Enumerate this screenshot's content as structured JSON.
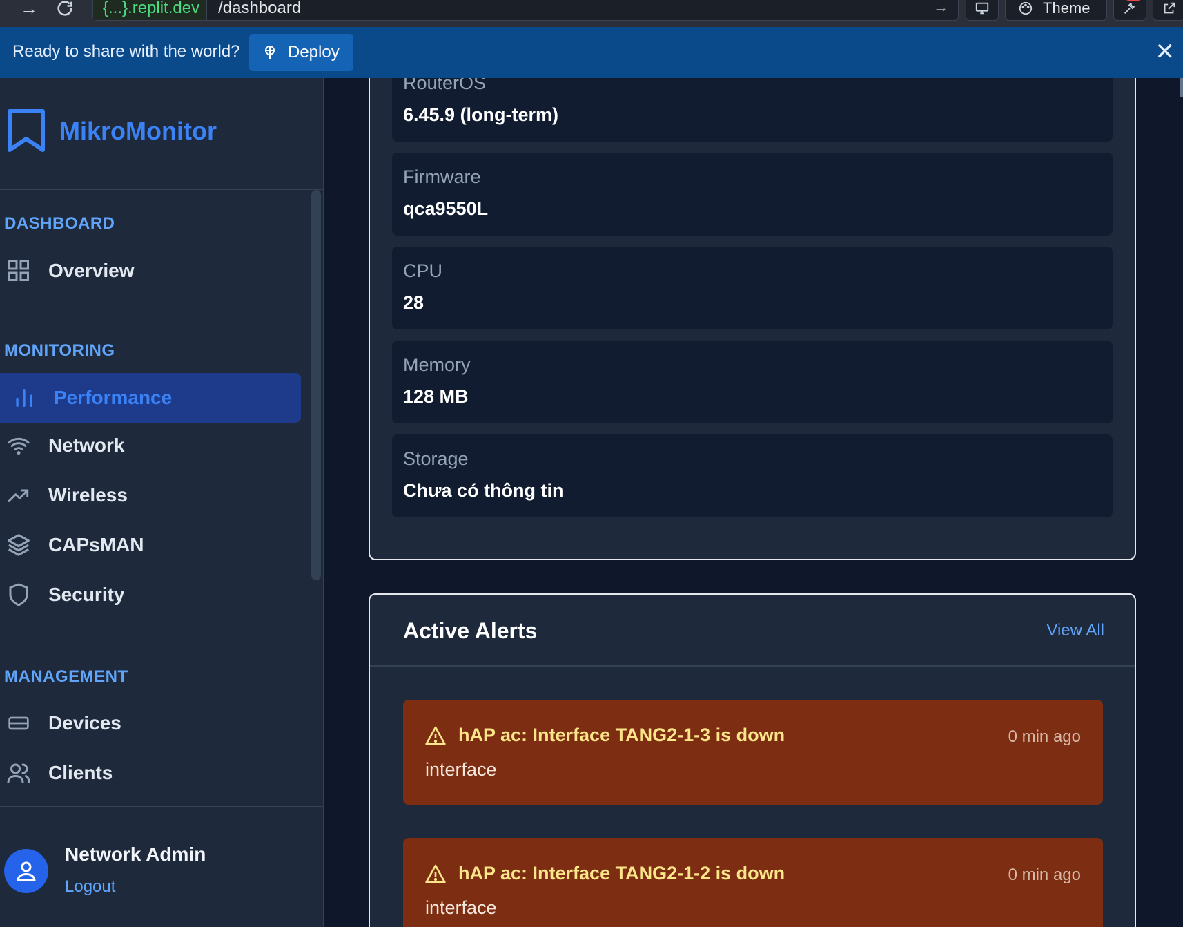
{
  "browser": {
    "url_host": "{...}.replit.dev",
    "url_path": "/dashboard",
    "theme_label": "Theme"
  },
  "banner": {
    "text": "Ready to share with the world?",
    "deploy_label": "Deploy"
  },
  "sidebar": {
    "brand": "MikroMonitor",
    "sections": {
      "dashboard": "DASHBOARD",
      "monitoring": "MONITORING",
      "management": "MANAGEMENT"
    },
    "items": {
      "overview": "Overview",
      "performance": "Performance",
      "network": "Network",
      "wireless": "Wireless",
      "capsman": "CAPsMAN",
      "security": "Security",
      "devices": "Devices",
      "clients": "Clients"
    },
    "active_item": "Performance",
    "user": {
      "name": "Network Admin",
      "logout": "Logout"
    }
  },
  "device_info": [
    {
      "label": "RouterOS",
      "value": "6.45.9 (long-term)"
    },
    {
      "label": "Firmware",
      "value": "qca9550L"
    },
    {
      "label": "CPU",
      "value": "28"
    },
    {
      "label": "Memory",
      "value": "128 MB"
    },
    {
      "label": "Storage",
      "value": "Chưa có thông tin"
    }
  ],
  "alerts": {
    "title": "Active Alerts",
    "view_all": "View All",
    "items": [
      {
        "title": "hAP ac: Interface TANG2-1-3 is down",
        "time": "0 min ago",
        "type": "interface"
      },
      {
        "title": "hAP ac: Interface TANG2-1-2 is down",
        "time": "0 min ago",
        "type": "interface"
      }
    ]
  },
  "colors": {
    "accent": "#3b82f6",
    "sidebar_bg": "#1e293b",
    "alert_bg": "#7c2d12",
    "banner_bg": "#0b4a8a"
  }
}
